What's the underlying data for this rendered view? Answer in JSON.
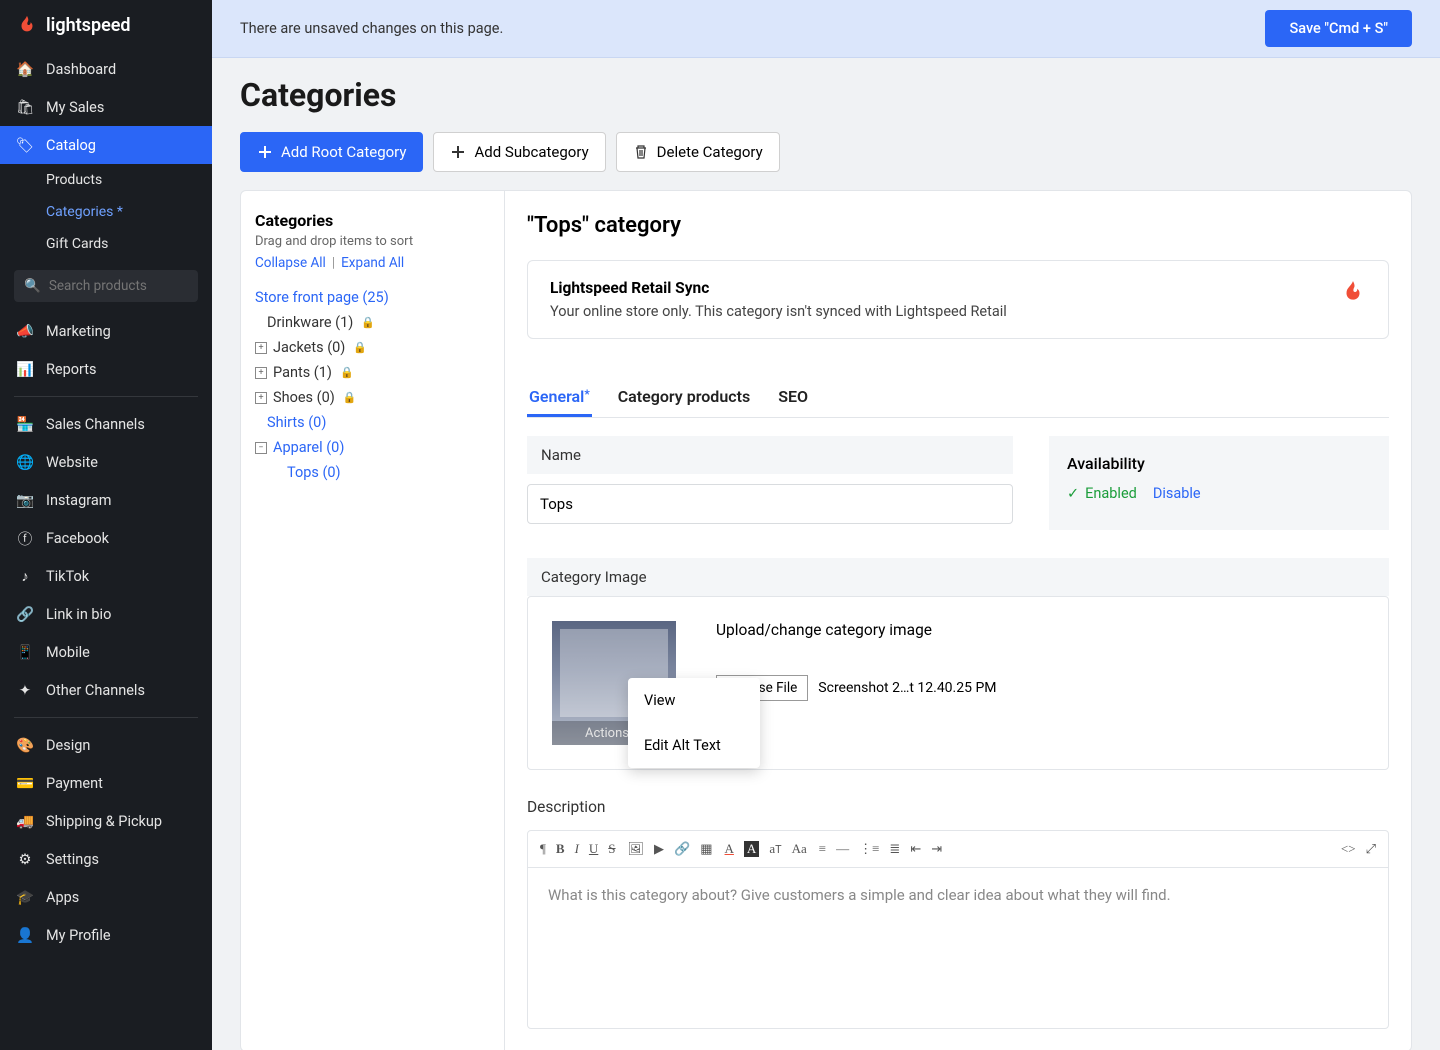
{
  "brand": "lightspeed",
  "sidebar": {
    "items": [
      {
        "label": "Dashboard"
      },
      {
        "label": "My Sales"
      },
      {
        "label": "Catalog"
      },
      {
        "label": "Marketing"
      },
      {
        "label": "Reports"
      },
      {
        "label": "Sales Channels"
      },
      {
        "label": "Website"
      },
      {
        "label": "Instagram"
      },
      {
        "label": "Facebook"
      },
      {
        "label": "TikTok"
      },
      {
        "label": "Link in bio"
      },
      {
        "label": "Mobile"
      },
      {
        "label": "Other Channels"
      },
      {
        "label": "Design"
      },
      {
        "label": "Payment"
      },
      {
        "label": "Shipping & Pickup"
      },
      {
        "label": "Settings"
      },
      {
        "label": "Apps"
      },
      {
        "label": "My Profile"
      }
    ],
    "catalog_sub": [
      {
        "label": "Products"
      },
      {
        "label": "Categories",
        "dirty": "*"
      },
      {
        "label": "Gift Cards"
      }
    ],
    "search_placeholder": "Search products"
  },
  "banner": {
    "text": "There are unsaved changes on this page.",
    "save": "Save \"Cmd + S\""
  },
  "page": {
    "title": "Categories",
    "add_root": "Add Root Category",
    "add_sub": "Add Subcategory",
    "delete": "Delete Category"
  },
  "tree": {
    "title": "Categories",
    "hint": "Drag and drop items to sort",
    "collapse": "Collapse All",
    "expand": "Expand All",
    "items": [
      {
        "label": "Store front page (25)"
      },
      {
        "label": "Drinkware (1)",
        "locked": true
      },
      {
        "label": "Jackets (0)",
        "exp": "+",
        "locked": true
      },
      {
        "label": "Pants (1)",
        "exp": "+",
        "locked": true
      },
      {
        "label": "Shoes (0)",
        "exp": "+",
        "locked": true
      },
      {
        "label": "Shirts (0)"
      },
      {
        "label": "Apparel (0)",
        "exp": "−"
      },
      {
        "label": "Tops (0)"
      }
    ]
  },
  "details": {
    "heading": "\"Tops\" category",
    "sync_title": "Lightspeed Retail Sync",
    "sync_text": "Your online store only. This category isn't synced with Lightspeed Retail",
    "tabs": {
      "general": "General",
      "products": "Category products",
      "seo": "SEO"
    },
    "name_label": "Name",
    "name_value": "Tops",
    "availability": "Availability",
    "enabled": "Enabled",
    "disable": "Disable",
    "image_label": "Category Image",
    "actions": "Actions",
    "upload_title": "Upload/change category image",
    "choose_file": "Choose File",
    "filename": "Screenshot 2…t 12.40.25 PM",
    "desc_label": "Description",
    "desc_placeholder": "What is this category about? Give customers a simple and clear idea about what they will find.",
    "menu": {
      "view": "View",
      "edit_alt": "Edit Alt Text"
    }
  }
}
